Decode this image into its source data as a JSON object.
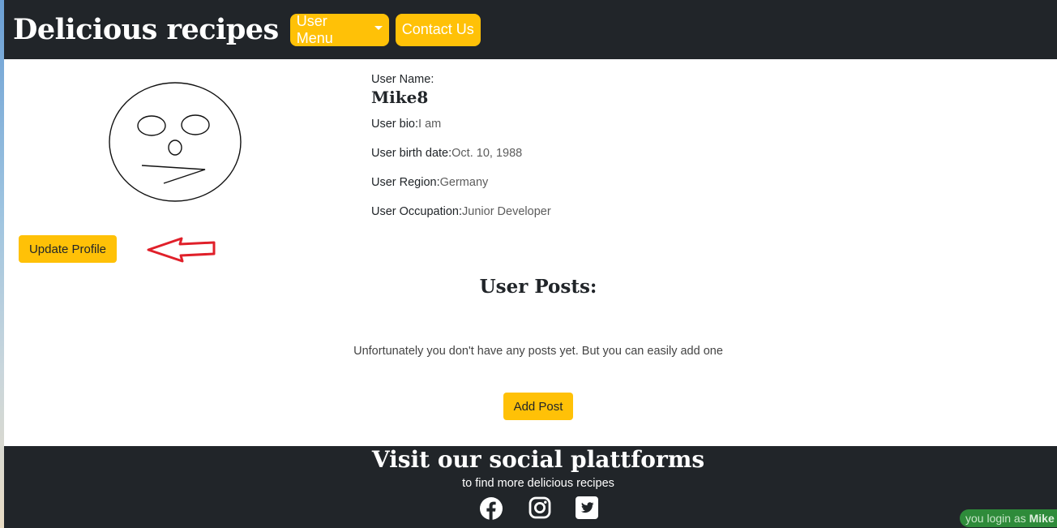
{
  "header": {
    "brand": "Delicious recipes",
    "user_menu_label": "User Menu",
    "contact_label": "Contact Us"
  },
  "profile": {
    "username_label": "User Name:",
    "username": "Mike8",
    "bio_label": "User bio:",
    "bio": "I am",
    "birth_label": "User birth date:",
    "birth": "Oct. 10, 1988",
    "region_label": "User Region:",
    "region": "Germany",
    "occupation_label": "User Occupation:",
    "occupation": "Junior Developer",
    "update_button": "Update Profile"
  },
  "posts": {
    "title": "User Posts:",
    "empty_message": "Unfortunately you don't have any posts yet. But you can easily add one",
    "add_button": "Add Post"
  },
  "footer": {
    "title": "Visit our social plattforms",
    "subtitle": "to find more delicious recipes",
    "icons": [
      "facebook-icon",
      "instagram-icon",
      "twitter-icon"
    ]
  },
  "login_status": {
    "prefix": "you login as ",
    "user": "Mike"
  },
  "colors": {
    "accent": "#ffc107",
    "dark": "#212529",
    "annotation_arrow": "#e0202a"
  }
}
